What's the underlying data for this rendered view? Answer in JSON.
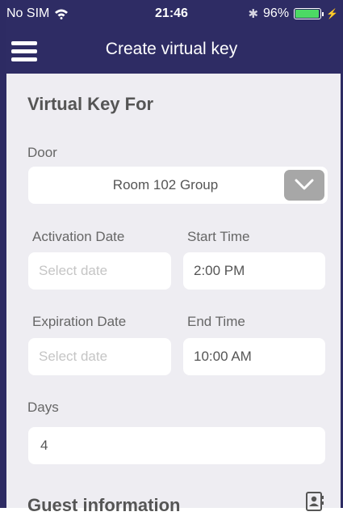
{
  "status_bar": {
    "carrier": "No SIM",
    "time": "21:46",
    "battery_percent": "96%",
    "battery_level": 0.96
  },
  "nav": {
    "title": "Create virtual key",
    "menu_icon": "hamburger-menu-icon"
  },
  "form": {
    "section_title": "Virtual Key For",
    "door": {
      "label": "Door",
      "value": "Room 102 Group",
      "dropdown_icon": "chevron-down-icon"
    },
    "activation_date": {
      "label": "Activation Date",
      "placeholder": "Select date"
    },
    "start_time": {
      "label": "Start Time",
      "value": "2:00 PM"
    },
    "expiration_date": {
      "label": "Expiration Date",
      "placeholder": "Select date"
    },
    "end_time": {
      "label": "End Time",
      "value": "10:00 AM"
    },
    "days": {
      "label": "Days",
      "value": "4"
    },
    "guest_section_title": "Guest information",
    "contacts_icon": "contacts-book-icon"
  },
  "colors": {
    "header_bg": "#2e2c64",
    "content_bg": "#eeedf2",
    "battery_fill": "#4cd964",
    "dropdown_bg": "#a7a7a7"
  }
}
